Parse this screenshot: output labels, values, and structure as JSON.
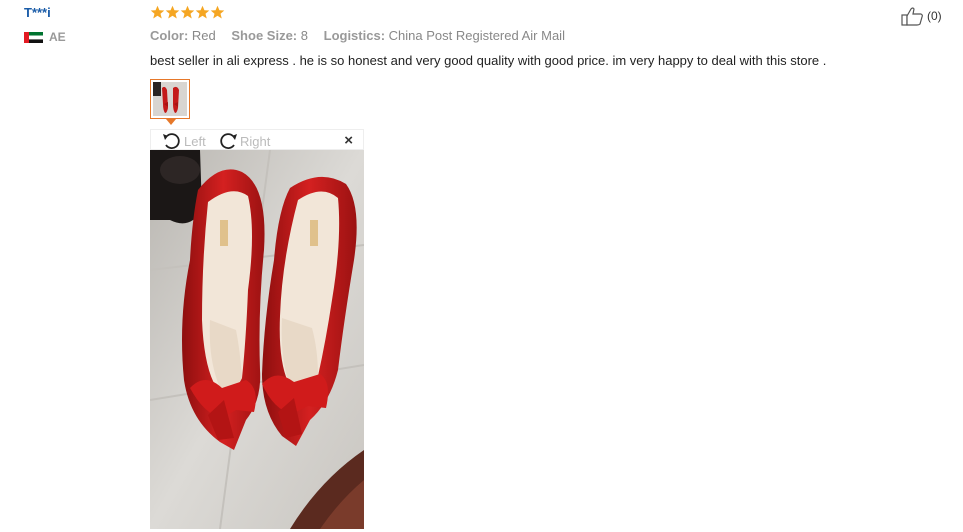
{
  "user": {
    "name": "T***i",
    "country": "AE",
    "flag_icon": "uae-flag-icon"
  },
  "review": {
    "rating": 5,
    "rating_max": 5,
    "star_color": "#f5a623",
    "color_key": "Color:",
    "color_val": "Red",
    "size_key": "Shoe Size:",
    "size_val": "8",
    "logistics_key": "Logistics:",
    "logistics_val": "China Post Registered Air Mail",
    "text": "best seller in ali express . he is so honest and very good quality with good price. im very happy to deal with this store ."
  },
  "viewer": {
    "rotate_left_label": "Left",
    "rotate_right_label": "Right",
    "close_label": "×"
  },
  "helpful": {
    "count": "(0)"
  },
  "colors": {
    "accent": "#e6782a",
    "link": "#1a5ca8",
    "shoe": "#cc1d1d"
  }
}
